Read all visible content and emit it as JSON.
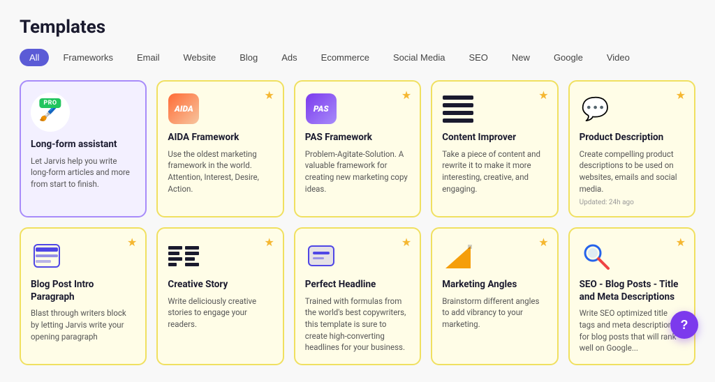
{
  "page": {
    "title": "Templates"
  },
  "filters": [
    {
      "id": "all",
      "label": "All",
      "active": true
    },
    {
      "id": "frameworks",
      "label": "Frameworks",
      "active": false
    },
    {
      "id": "email",
      "label": "Email",
      "active": false
    },
    {
      "id": "website",
      "label": "Website",
      "active": false
    },
    {
      "id": "blog",
      "label": "Blog",
      "active": false
    },
    {
      "id": "ads",
      "label": "Ads",
      "active": false
    },
    {
      "id": "ecommerce",
      "label": "Ecommerce",
      "active": false
    },
    {
      "id": "social-media",
      "label": "Social Media",
      "active": false
    },
    {
      "id": "seo",
      "label": "SEO",
      "active": false
    },
    {
      "id": "new",
      "label": "New",
      "active": false
    },
    {
      "id": "google",
      "label": "Google",
      "active": false
    },
    {
      "id": "video",
      "label": "Video",
      "active": false
    }
  ],
  "cards_row1": [
    {
      "id": "long-form",
      "featured": true,
      "pro": true,
      "title": "Long-form assistant",
      "desc": "Let Jarvis help you write long-form articles and more from start to finish.",
      "star": false,
      "icon": "brush",
      "updated": ""
    },
    {
      "id": "aida",
      "featured": false,
      "pro": false,
      "title": "AIDA Framework",
      "desc": "Use the oldest marketing framework in the world. Attention, Interest, Desire, Action.",
      "star": true,
      "icon": "aida",
      "updated": ""
    },
    {
      "id": "pas",
      "featured": false,
      "pro": false,
      "title": "PAS Framework",
      "desc": "Problem-Agitate-Solution. A valuable framework for creating new marketing copy ideas.",
      "star": true,
      "icon": "pas",
      "updated": ""
    },
    {
      "id": "content-improver",
      "featured": false,
      "pro": false,
      "title": "Content Improver",
      "desc": "Take a piece of content and rewrite it to make it more interesting, creative, and engaging.",
      "star": true,
      "icon": "lines",
      "updated": ""
    },
    {
      "id": "product-description",
      "featured": false,
      "pro": false,
      "title": "Product Description",
      "desc": "Create compelling product descriptions to be used on websites, emails and social media.",
      "star": true,
      "icon": "speech",
      "updated": "Updated: 24h ago"
    }
  ],
  "cards_row2": [
    {
      "id": "blog-post-intro",
      "featured": false,
      "pro": false,
      "title": "Blog Post Intro Paragraph",
      "desc": "Blast through writers block by letting Jarvis write your opening paragraph",
      "star": true,
      "icon": "chat",
      "updated": ""
    },
    {
      "id": "creative-story",
      "featured": false,
      "pro": false,
      "title": "Creative Story",
      "desc": "Write deliciously creative stories to engage your readers.",
      "star": true,
      "icon": "grid-lines",
      "updated": ""
    },
    {
      "id": "perfect-headline",
      "featured": false,
      "pro": false,
      "title": "Perfect Headline",
      "desc": "Trained with formulas from the world's best copywriters, this template is sure to create high-converting headlines for your business.",
      "star": true,
      "icon": "chat2",
      "updated": ""
    },
    {
      "id": "marketing-angles",
      "featured": false,
      "pro": false,
      "title": "Marketing Angles",
      "desc": "Brainstorm different angles to add vibrancy to your marketing.",
      "star": true,
      "icon": "triangle",
      "updated": ""
    },
    {
      "id": "seo-blog",
      "featured": false,
      "pro": false,
      "title": "SEO - Blog Posts - Title and Meta Descriptions",
      "desc": "Write SEO optimized title tags and meta descriptions for blog posts that will rank well on Google...",
      "star": true,
      "icon": "magnifier",
      "updated": ""
    }
  ],
  "help_label": "?"
}
